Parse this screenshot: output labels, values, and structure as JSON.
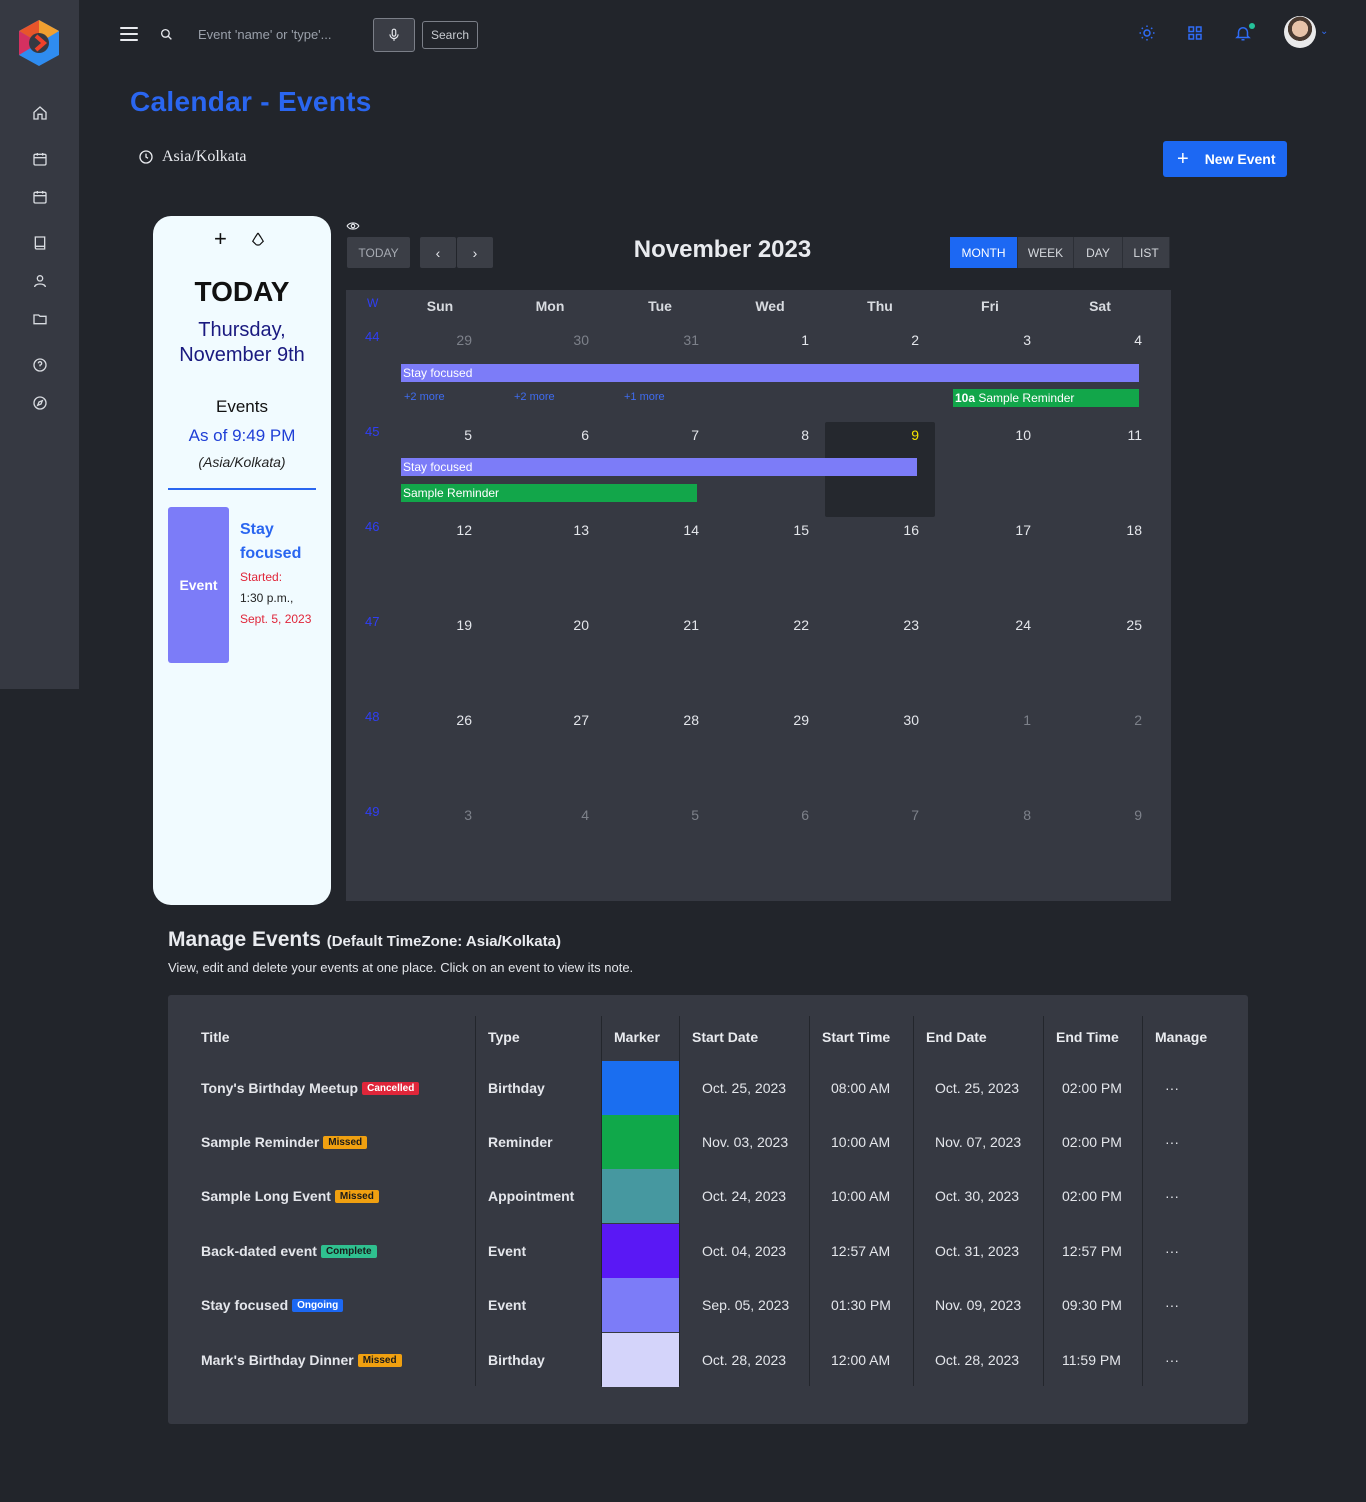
{
  "search": {
    "placeholder": "Event 'name' or 'type'...",
    "button": "Search"
  },
  "page": {
    "title": "Calendar - Events",
    "timezone": "Asia/Kolkata",
    "new_event": "New Event"
  },
  "today_card": {
    "heading": "TODAY",
    "date_line1": "Thursday,",
    "date_line2": "November 9th",
    "events_label": "Events",
    "as_of": "As of 9:49 PM",
    "tz": "(Asia/Kolkata)",
    "event_type": "Event",
    "event_title": "Stay focused",
    "started_label": "Started:",
    "started_time": "1:30 p.m.,",
    "started_date": "Sept. 5, 2023"
  },
  "calendar": {
    "today_btn": "TODAY",
    "prev": "‹",
    "next": "›",
    "title": "November 2023",
    "views": [
      "MONTH",
      "WEEK",
      "DAY",
      "LIST"
    ],
    "active_view": "MONTH",
    "week_header": "W",
    "days_of_week": [
      "Sun",
      "Mon",
      "Tue",
      "Wed",
      "Thu",
      "Fri",
      "Sat"
    ],
    "weeks": [
      {
        "num": "44",
        "days": [
          "29",
          "30",
          "31",
          "1",
          "2",
          "3",
          "4"
        ]
      },
      {
        "num": "45",
        "days": [
          "5",
          "6",
          "7",
          "8",
          "9",
          "10",
          "11"
        ]
      },
      {
        "num": "46",
        "days": [
          "12",
          "13",
          "14",
          "15",
          "16",
          "17",
          "18"
        ]
      },
      {
        "num": "47",
        "days": [
          "19",
          "20",
          "21",
          "22",
          "23",
          "24",
          "25"
        ]
      },
      {
        "num": "48",
        "days": [
          "26",
          "27",
          "28",
          "29",
          "30",
          "1",
          "2"
        ]
      },
      {
        "num": "49",
        "days": [
          "3",
          "4",
          "5",
          "6",
          "7",
          "8",
          "9"
        ]
      }
    ],
    "events": {
      "w44_bar": "Stay focused",
      "w44_more": [
        "+2 more",
        "+2 more",
        "+1 more"
      ],
      "w44_reminder_time": "10a",
      "w44_reminder": "Sample Reminder",
      "w45_bar": "Stay focused",
      "w45_reminder": "Sample Reminder"
    }
  },
  "manage": {
    "title": "Manage Events",
    "subtitle": "(Default TimeZone: Asia/Kolkata)",
    "description": "View, edit and delete your events at one place. Click on an event to view its note.",
    "columns": [
      "Title",
      "Type",
      "Marker",
      "Start Date",
      "Start Time",
      "End Date",
      "End Time",
      "Manage"
    ],
    "rows": [
      {
        "title": "Tony's Birthday Meetup",
        "badge": "Cancelled",
        "badge_color": "#e0263a",
        "type": "Birthday",
        "marker": "#1a6ef0",
        "start_date": "Oct. 25, 2023",
        "start_time": "08:00 AM",
        "end_date": "Oct. 25, 2023",
        "end_time": "02:00 PM",
        "manage": "···"
      },
      {
        "title": "Sample Reminder",
        "badge": "Missed",
        "badge_color": "#f0a010",
        "type": "Reminder",
        "marker": "#10a84a",
        "start_date": "Nov. 03, 2023",
        "start_time": "10:00 AM",
        "end_date": "Nov. 07, 2023",
        "end_time": "02:00 PM",
        "manage": "···"
      },
      {
        "title": "Sample Long Event",
        "badge": "Missed",
        "badge_color": "#f0a010",
        "type": "Appointment",
        "marker": "#4698a0",
        "start_date": "Oct. 24, 2023",
        "start_time": "10:00 AM",
        "end_date": "Oct. 30, 2023",
        "end_time": "02:00 PM",
        "manage": "···"
      },
      {
        "title": "Back-dated event",
        "badge": "Complete",
        "badge_color": "#2fc08f",
        "type": "Event",
        "marker": "#5a18f5",
        "start_date": "Oct. 04, 2023",
        "start_time": "12:57 AM",
        "end_date": "Oct. 31, 2023",
        "end_time": "12:57 PM",
        "manage": "···"
      },
      {
        "title": "Stay focused",
        "badge": "Ongoing",
        "badge_color": "#1c68f3",
        "type": "Event",
        "marker": "#7c7cf8",
        "start_date": "Sep. 05, 2023",
        "start_time": "01:30 PM",
        "end_date": "Nov. 09, 2023",
        "end_time": "09:30 PM",
        "manage": "···"
      },
      {
        "title": "Mark's Birthday Dinner",
        "badge": "Missed",
        "badge_color": "#f0a010",
        "type": "Birthday",
        "marker": "#d4d4fa",
        "start_date": "Oct. 28, 2023",
        "start_time": "12:00 AM",
        "end_date": "Oct. 28, 2023",
        "end_time": "11:59 PM",
        "manage": "···"
      }
    ]
  }
}
